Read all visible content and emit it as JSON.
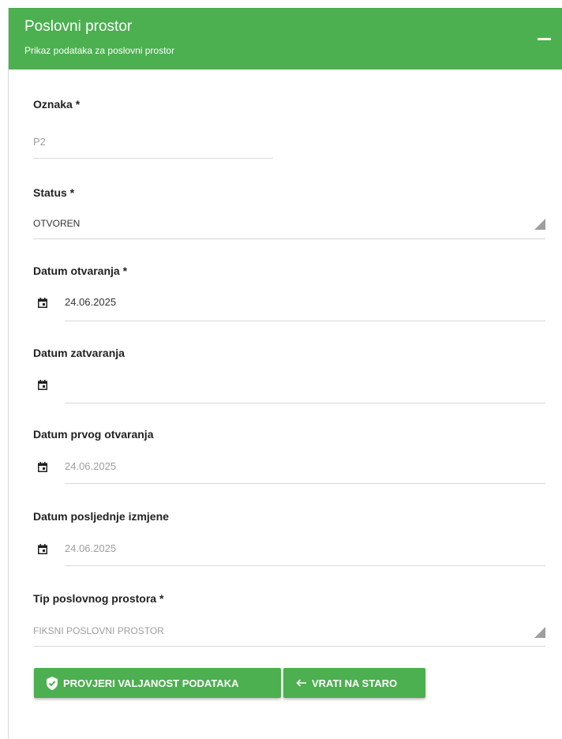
{
  "header": {
    "title": "Poslovni prostor",
    "subtitle": "Prikaz podataka za poslovni prostor",
    "collapse_icon": "minus-icon"
  },
  "form": {
    "oznaka": {
      "label": "Oznaka *",
      "value": "P2"
    },
    "status": {
      "label": "Status *",
      "value": "OTVOREN"
    },
    "datum_otvaranja": {
      "label": "Datum otvaranja *",
      "value": "24.06.2025"
    },
    "datum_zatvaranja": {
      "label": "Datum zatvaranja",
      "value": ""
    },
    "datum_prvog_otvaranja": {
      "label": "Datum prvog otvaranja",
      "value": "24.06.2025"
    },
    "datum_posljednje_izmjene": {
      "label": "Datum posljednje izmjene",
      "value": "24.06.2025"
    },
    "tip_poslovnog_prostora": {
      "label": "Tip poslovnog prostora *",
      "value": "FIKSNI POSLOVNI PROSTOR"
    }
  },
  "buttons": {
    "validate": {
      "label": "PROVJERI VALJANOST PODATAKA",
      "icon": "shield-check-icon"
    },
    "revert": {
      "label": "VRATI NA STARO",
      "icon": "arrow-left-icon"
    }
  },
  "colors": {
    "accent": "#4caf50",
    "text": "#222222",
    "muted": "#9e9e9e",
    "divider": "#d9d9d9"
  }
}
